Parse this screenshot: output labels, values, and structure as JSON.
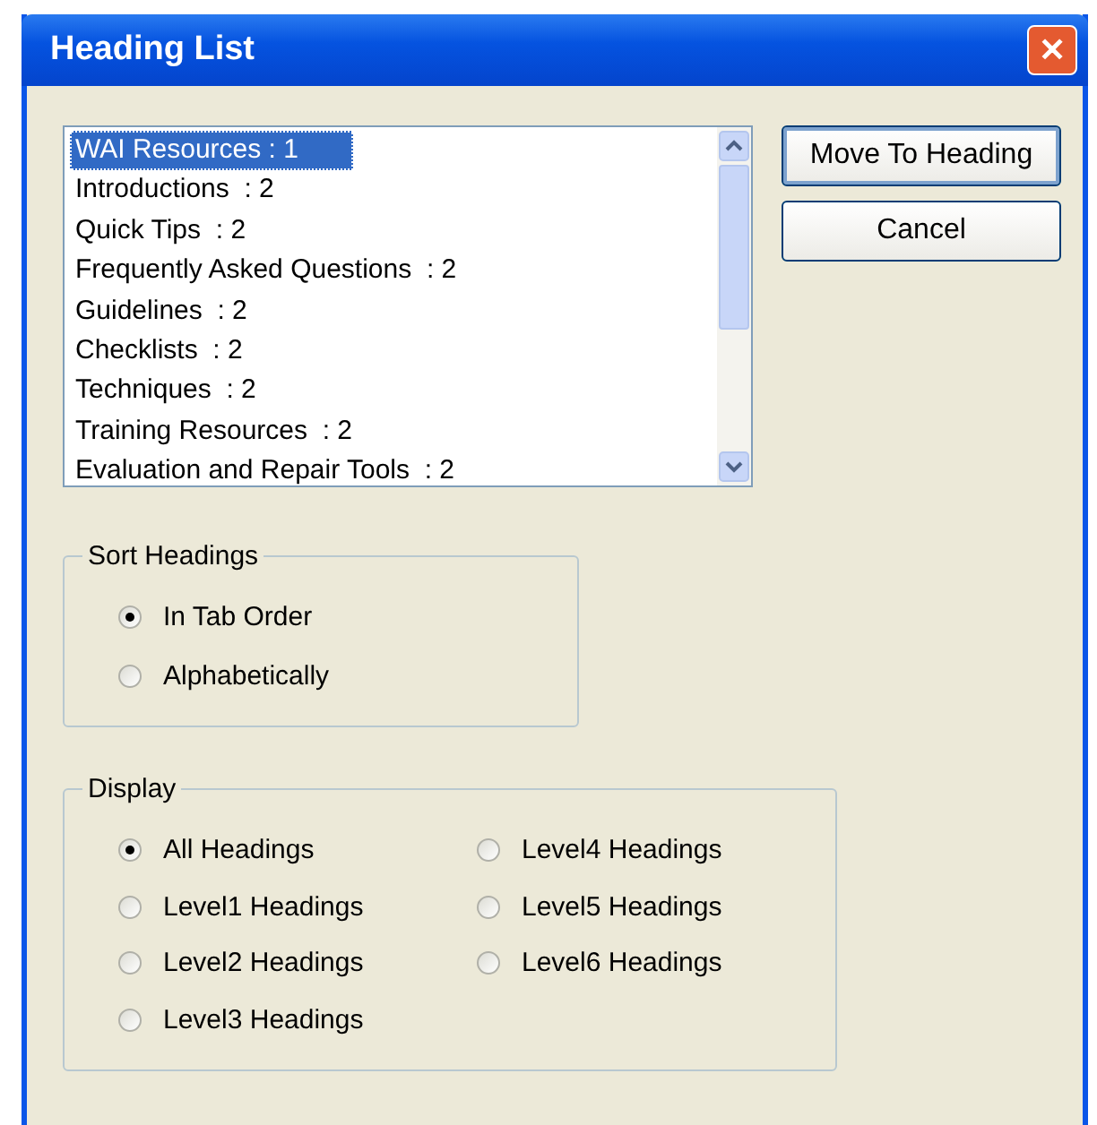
{
  "window": {
    "title": "Heading List",
    "close": "✕"
  },
  "list": {
    "items": [
      {
        "text": "WAI Resources : 1",
        "selected": true
      },
      {
        "text": "Introductions  : 2",
        "selected": false
      },
      {
        "text": "Quick Tips  : 2",
        "selected": false
      },
      {
        "text": "Frequently Asked Questions  : 2",
        "selected": false
      },
      {
        "text": "Guidelines  : 2",
        "selected": false
      },
      {
        "text": "Checklists  : 2",
        "selected": false
      },
      {
        "text": "Techniques  : 2",
        "selected": false
      },
      {
        "text": "Training Resources  : 2",
        "selected": false
      },
      {
        "text": "Evaluation and Repair Tools  : 2",
        "selected": false
      }
    ]
  },
  "buttons": [
    {
      "label": "Move To Heading",
      "default": true
    },
    {
      "label": "Cancel",
      "default": false
    }
  ],
  "sort_group": {
    "title": "Sort Headings",
    "options": [
      {
        "label": "In Tab Order",
        "selected": true
      },
      {
        "label": "Alphabetically",
        "selected": false
      }
    ]
  },
  "display_group": {
    "title": "Display",
    "options": [
      {
        "label": "All Headings",
        "selected": true
      },
      {
        "label": "Level1 Headings",
        "selected": false
      },
      {
        "label": "Level2 Headings",
        "selected": false
      },
      {
        "label": "Level3 Headings",
        "selected": false
      },
      {
        "label": "Level4 Headings",
        "selected": false
      },
      {
        "label": "Level5 Headings",
        "selected": false
      },
      {
        "label": "Level6 Headings",
        "selected": false
      }
    ]
  }
}
